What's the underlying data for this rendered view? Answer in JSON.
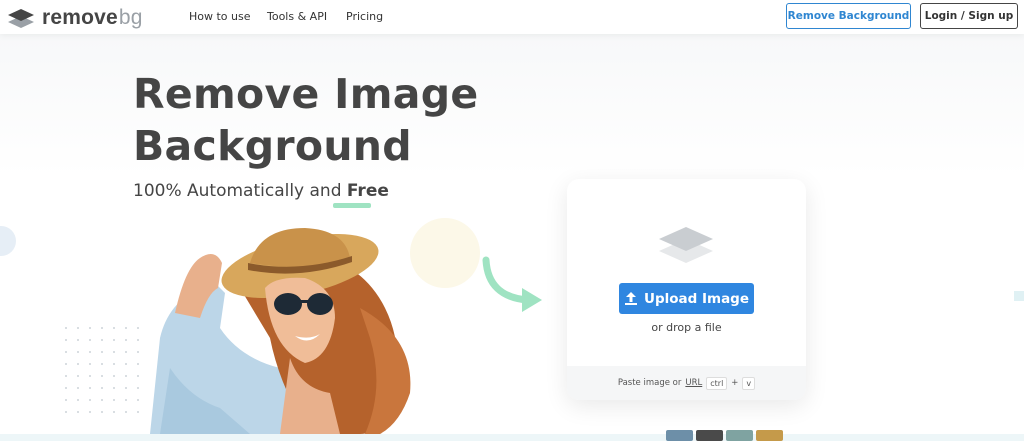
{
  "header": {
    "logo_text_main": "remove",
    "logo_text_accent": "bg",
    "nav": [
      "How to use",
      "Tools & API",
      "Pricing"
    ],
    "remove_background_label": "Remove Background",
    "login_label": "Login / Sign up"
  },
  "hero": {
    "title_line1": "Remove Image",
    "title_line2": "Background",
    "subtitle_prefix": "100% Automatically and ",
    "subtitle_emphasis": "Free"
  },
  "upload_card": {
    "button_label": "Upload Image",
    "drop_text": "or drop a file",
    "paste_prefix": "Paste image or",
    "paste_url": "URL",
    "key_ctrl": "ctrl",
    "key_plus": "+",
    "key_v": "v"
  },
  "colors": {
    "brand_blue": "#2f86e0",
    "text_dark": "#454545",
    "accent_green": "#9fe3c2"
  },
  "icons": {
    "logo": "layers-icon",
    "card": "layers-icon",
    "upload": "upload-icon",
    "arrow": "curved-arrow-icon"
  }
}
